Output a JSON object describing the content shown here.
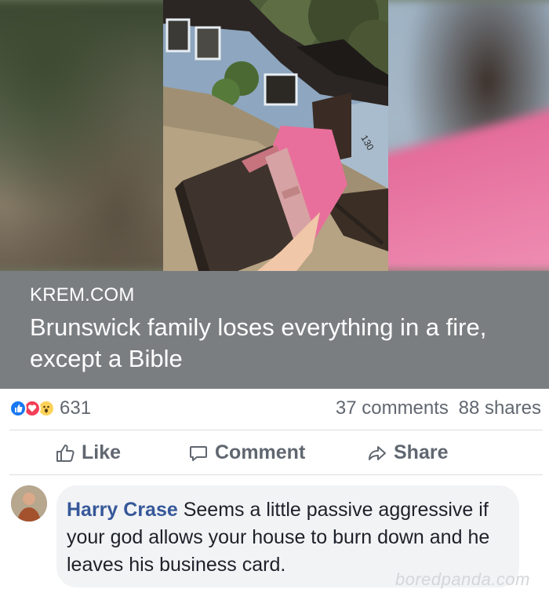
{
  "link": {
    "domain": "KREM.COM",
    "title": "Brunswick family loses everything in a fire, except a Bible",
    "house_number": "130"
  },
  "reactions": {
    "count": "631",
    "types": [
      "like-icon",
      "love-icon",
      "wow-icon"
    ],
    "comments": "37 comments",
    "shares": "88 shares"
  },
  "actions": {
    "like_label": "Like",
    "comment_label": "Comment",
    "share_label": "Share"
  },
  "comment": {
    "author": "Harry Crase",
    "text": "Seems a little passive aggressive if your god allows your house to burn down and he leaves his business card."
  },
  "watermark": "boredpanda.com",
  "colors": {
    "facebook_blue": "#365899",
    "title_bar": "#7b7e81",
    "action_gray": "#606770",
    "like_blue": "#1877f2",
    "love_red": "#f33e58",
    "wow_yellow": "#fcd259"
  }
}
